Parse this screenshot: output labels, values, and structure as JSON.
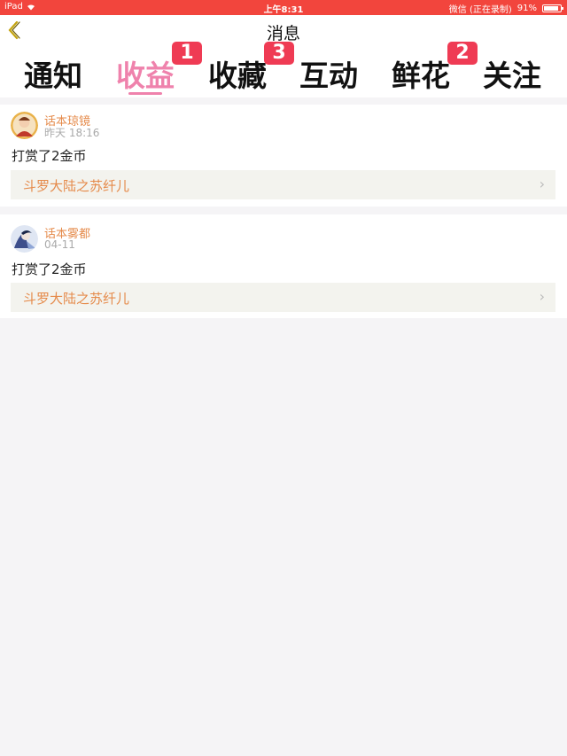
{
  "status_bar": {
    "device": "iPad",
    "time": "上午8:31",
    "app_status": "微信 (正在录制)",
    "battery_percent": "91%",
    "battery_level": 0.91
  },
  "nav": {
    "title": "消息",
    "back_icon": "chevron-left-icon"
  },
  "tabs": [
    {
      "label": "通知",
      "badge": ""
    },
    {
      "label": "收益",
      "badge": "1"
    },
    {
      "label": "收藏",
      "badge": "3"
    },
    {
      "label": "互动",
      "badge": ""
    },
    {
      "label": "鲜花",
      "badge": "2"
    },
    {
      "label": "关注",
      "badge": ""
    }
  ],
  "active_tab_index": 1,
  "colors": {
    "status_bar": "#f2453d",
    "active_tab": "#ef82ac",
    "badge": "#ef3b54",
    "name_text": "#e58a4a",
    "link_bg": "#f3f3ee"
  },
  "messages": [
    {
      "user": "话本琼镜",
      "time": "昨天 18:16",
      "text": "打赏了2金币",
      "link": "斗罗大陆之苏纤儿"
    },
    {
      "user": "话本雾都",
      "time": "04-11",
      "text": "打赏了2金币",
      "link": "斗罗大陆之苏纤儿"
    }
  ]
}
